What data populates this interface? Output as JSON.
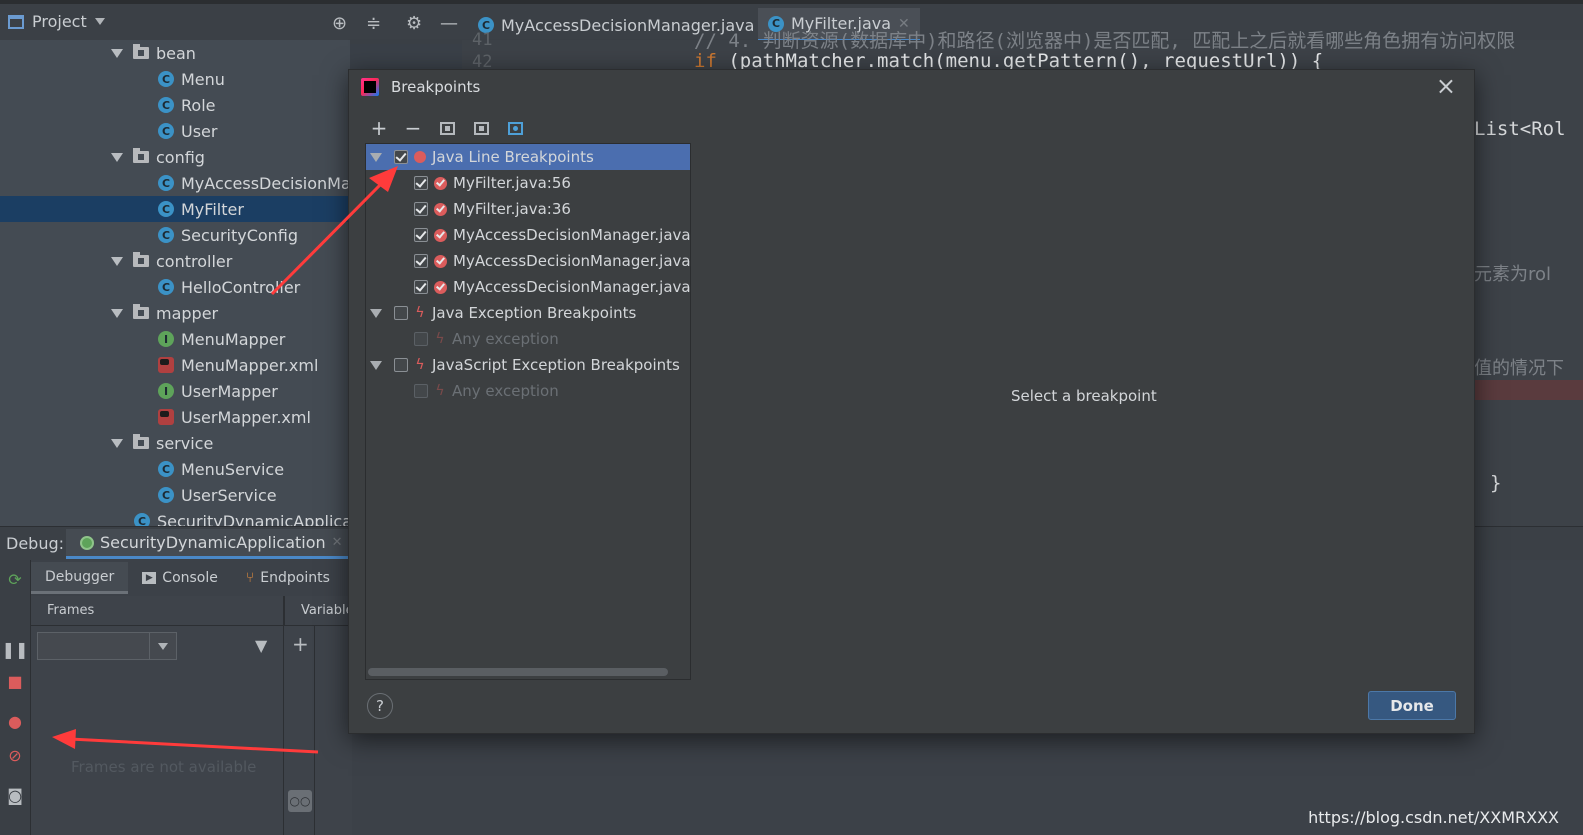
{
  "topbar": {
    "project_label": "Project",
    "tabs": [
      {
        "label": "MyAccessDecisionManager.java",
        "icon": "C",
        "active": false
      },
      {
        "label": "MyFilter.java",
        "icon": "C",
        "active": true
      }
    ]
  },
  "tree": {
    "items": [
      {
        "label": "bean",
        "type": "folder"
      },
      {
        "label": "Menu",
        "type": "class",
        "icon": "C"
      },
      {
        "label": "Role",
        "type": "class",
        "icon": "C"
      },
      {
        "label": "User",
        "type": "class",
        "icon": "C"
      },
      {
        "label": "config",
        "type": "folder"
      },
      {
        "label": "MyAccessDecisionManager",
        "type": "class",
        "icon": "C"
      },
      {
        "label": "MyFilter",
        "type": "class",
        "icon": "C",
        "selected": true
      },
      {
        "label": "SecurityConfig",
        "type": "class",
        "icon": "C"
      },
      {
        "label": "controller",
        "type": "folder"
      },
      {
        "label": "HelloController",
        "type": "class",
        "icon": "C"
      },
      {
        "label": "mapper",
        "type": "folder"
      },
      {
        "label": "MenuMapper",
        "type": "interface",
        "icon": "I"
      },
      {
        "label": "MenuMapper.xml",
        "type": "xml"
      },
      {
        "label": "UserMapper",
        "type": "interface",
        "icon": "I"
      },
      {
        "label": "UserMapper.xml",
        "type": "xml"
      },
      {
        "label": "service",
        "type": "folder"
      },
      {
        "label": "MenuService",
        "type": "class",
        "icon": "C"
      },
      {
        "label": "UserService",
        "type": "class",
        "icon": "C"
      },
      {
        "label": "SecurityDynamicApplication",
        "type": "class",
        "icon": "C"
      }
    ]
  },
  "editor": {
    "line_numbers": [
      "41",
      "42"
    ],
    "code_line_1": "// 4. 判断资源(数据库中)和路径(浏览器中)是否匹配, 匹配上之后就看哪些角色拥有访问权限",
    "code_line_2_kw": "if",
    "code_line_2_rest": " (pathMatcher.match(menu.getPattern(), requestUrl)) {",
    "fragment_1": "List<Rol",
    "fragment_2": "元素为rol",
    "fragment_3": "值的情况下",
    "fragment_4": "}"
  },
  "debug": {
    "label": "Debug:",
    "session_tab": "SecurityDynamicApplication",
    "subtabs": [
      "Debugger",
      "Console",
      "Endpoints"
    ],
    "frames_header": "Frames",
    "variables_header": "Variables",
    "frames_empty": "Frames are not available"
  },
  "dialog": {
    "title": "Breakpoints",
    "groups": [
      {
        "label": "Java Line Breakpoints",
        "checked": true,
        "selected": true,
        "items": [
          {
            "label": "MyFilter.java:56",
            "checked": true
          },
          {
            "label": "MyFilter.java:36",
            "checked": true
          },
          {
            "label": "MyAccessDecisionManager.java:",
            "checked": true
          },
          {
            "label": "MyAccessDecisionManager.java:",
            "checked": true
          },
          {
            "label": "MyAccessDecisionManager.java:",
            "checked": true
          }
        ]
      },
      {
        "label": "Java Exception Breakpoints",
        "checked": false,
        "items": [
          {
            "label": "Any exception",
            "checked": false
          }
        ]
      },
      {
        "label": "JavaScript Exception Breakpoints",
        "checked": false,
        "items": [
          {
            "label": "Any exception",
            "checked": false
          }
        ]
      }
    ],
    "empty_message": "Select a breakpoint",
    "help_label": "?",
    "done_label": "Done",
    "close_label": "×"
  },
  "watermark": "https://blog.csdn.net/XXMRXXX",
  "colors": {
    "selection": "#4b6eaf",
    "breakpoint_red": "#db5c5c",
    "annotation_arrow": "#ff3b3b",
    "primary_button": "#365880"
  }
}
